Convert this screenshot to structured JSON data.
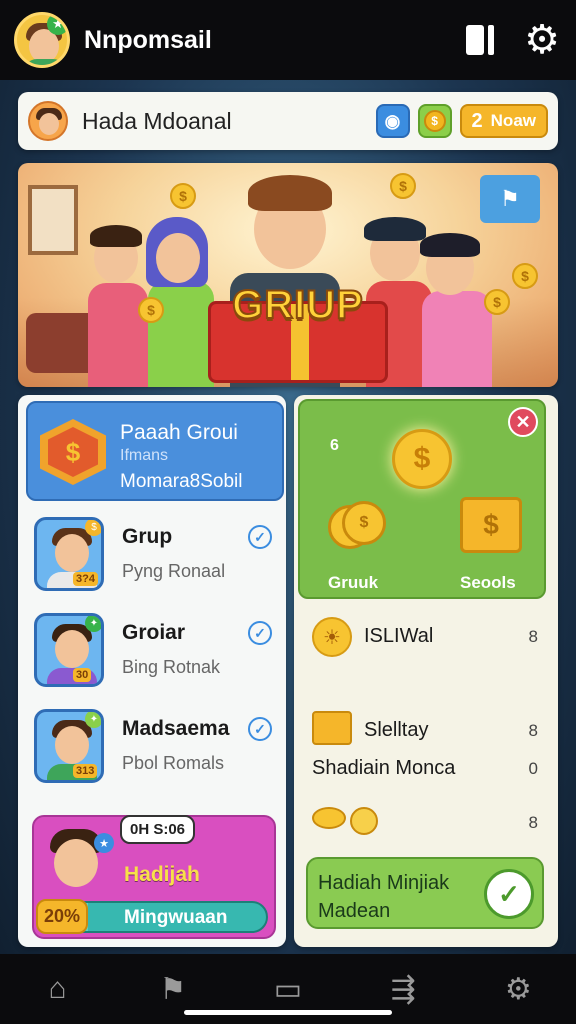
{
  "app": {
    "title": "Nnpomsail",
    "top_icons": [
      "document-icon",
      "gear-icon"
    ]
  },
  "header": {
    "name": "Hada Mdoanal",
    "now_button": {
      "count": "2",
      "label": "Noaw"
    }
  },
  "banner": {
    "title": "GRIUP"
  },
  "group_card": {
    "title": "Paaah Groui",
    "subtitle": "Ifmans",
    "footer": "Momara8Sobil"
  },
  "members": [
    {
      "name": "Grup",
      "sub": "Pyng Ronaal",
      "level": "3?4"
    },
    {
      "name": "Groiar",
      "sub": "Bing Rotnak",
      "level": "30"
    },
    {
      "name": "Madsaema",
      "sub": "Pbol Romals",
      "level": "313"
    }
  ],
  "gift_card": {
    "timer": "0H S:06",
    "label": "Hadijah",
    "progress_pct_text": "20%",
    "progress": 0.2,
    "progress_label": "Mingwuaan"
  },
  "reward_card": {
    "corner": "6",
    "left_label": "Gruuk",
    "right_label": "Seools"
  },
  "rows": [
    {
      "label": "ISLIWal",
      "side": "8",
      "icon": "sun-icon"
    },
    {
      "label": "Slelltay",
      "side": "8",
      "icon": "gold-bars-icon"
    },
    {
      "label": "Shadiain Monca",
      "side": "0",
      "icon": ""
    },
    {
      "label": "",
      "side": "8",
      "icon": "coins-icon"
    }
  ],
  "claim": {
    "line1": "Hadiah Minjiak",
    "line2": "Madean"
  },
  "bottom_nav": [
    "home-icon",
    "flag-icon",
    "inbox-icon",
    "share-icon",
    "settings-icon"
  ],
  "colors": {
    "primary_blue": "#4a8fdc",
    "reward_green": "#7bbd4a",
    "gift_pink": "#d94fc0",
    "coin_gold": "#f7c431"
  }
}
